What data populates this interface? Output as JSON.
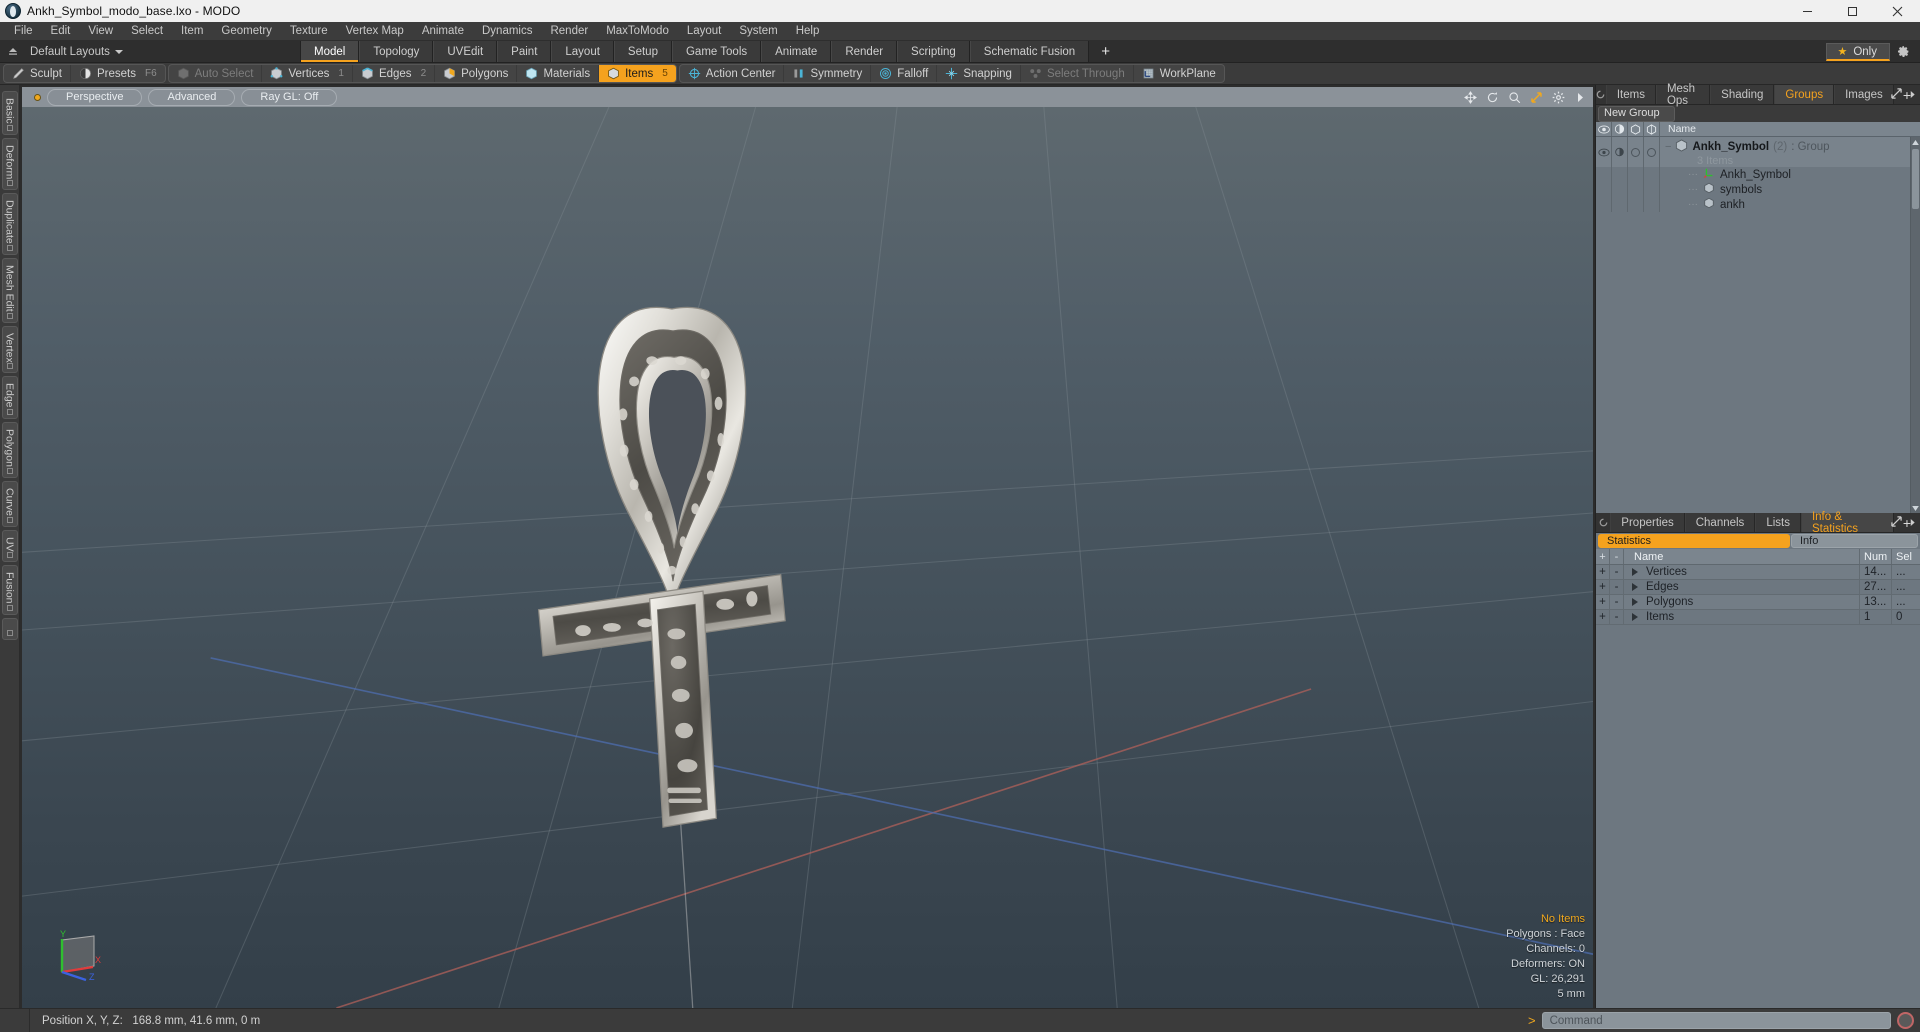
{
  "window": {
    "title": "Ankh_Symbol_modo_base.lxo - MODO",
    "app_icon": "modo-app-icon",
    "controls": {
      "minimize": "minimize-icon",
      "maximize": "maximize-icon",
      "close": "close-icon"
    }
  },
  "menu": {
    "items": [
      "File",
      "Edit",
      "View",
      "Select",
      "Item",
      "Geometry",
      "Texture",
      "Vertex Map",
      "Animate",
      "Dynamics",
      "Render",
      "MaxToModo",
      "Layout",
      "System",
      "Help"
    ]
  },
  "layout_bar": {
    "layout_selector": "Default Layouts",
    "tabs": [
      "Model",
      "Topology",
      "UVEdit",
      "Paint",
      "Layout",
      "Setup",
      "Game Tools",
      "Animate",
      "Render",
      "Scripting",
      "Schematic Fusion"
    ],
    "active_tab": "Model",
    "add_tab": "+",
    "only_label": "Only",
    "only_star": "★"
  },
  "mode_toolbar": {
    "groups": [
      {
        "buttons": [
          {
            "label": "Sculpt",
            "icon": "sculpt-icon",
            "state": "normal",
            "num": ""
          },
          {
            "label": "Presets",
            "icon": "presets-icon",
            "state": "normal",
            "num": "F6"
          }
        ]
      },
      {
        "buttons": [
          {
            "label": "Auto Select",
            "icon": "auto-select-icon",
            "state": "dim",
            "num": ""
          },
          {
            "label": "Vertices",
            "icon": "vertices-icon",
            "state": "normal",
            "num": "1"
          },
          {
            "label": "Edges",
            "icon": "edges-icon",
            "state": "normal",
            "num": "2"
          },
          {
            "label": "Polygons",
            "icon": "polygons-icon",
            "state": "normal",
            "num": ""
          },
          {
            "label": "Materials",
            "icon": "materials-icon",
            "state": "normal",
            "num": ""
          },
          {
            "label": "Items",
            "icon": "items-icon",
            "state": "selected",
            "num": "5"
          }
        ]
      },
      {
        "buttons": [
          {
            "label": "Action Center",
            "icon": "action-center-icon",
            "state": "normal",
            "num": ""
          },
          {
            "label": "Symmetry",
            "icon": "symmetry-icon",
            "state": "normal",
            "num": ""
          },
          {
            "label": "Falloff",
            "icon": "falloff-icon",
            "state": "normal",
            "num": ""
          },
          {
            "label": "Snapping",
            "icon": "snapping-icon",
            "state": "normal",
            "num": ""
          },
          {
            "label": "Select Through",
            "icon": "select-through-icon",
            "state": "dim",
            "num": ""
          },
          {
            "label": "WorkPlane",
            "icon": "workplane-icon",
            "state": "normal",
            "num": ""
          }
        ]
      }
    ]
  },
  "left_tabs": [
    "Basic",
    "Deform",
    "Duplicate",
    "Mesh Edit",
    "Vertex",
    "Edge",
    "Polygon",
    "Curve",
    "UV",
    "Fusion"
  ],
  "viewport": {
    "header_buttons": [
      "Perspective",
      "Advanced",
      "Ray GL: Off"
    ],
    "header_icons": [
      "pan-icon",
      "rotate-icon",
      "zoom-icon",
      "fit-icon",
      "gear-icon",
      "chevron-right-icon"
    ],
    "hud": {
      "no_items": "No Items",
      "polygons": "Polygons : Face",
      "channels": "Channels: 0",
      "deformers": "Deformers: ON",
      "gl": "GL: 26,291",
      "scale": "5 mm"
    },
    "gizmo_axes": {
      "x": "X",
      "y": "Y",
      "z": "Z"
    }
  },
  "items_panel": {
    "tabs": [
      "Items",
      "Mesh Ops",
      "Shading",
      "Groups",
      "Images"
    ],
    "active_tab": "Groups",
    "add_tab": "+",
    "new_group_label": "New Group",
    "columns": {
      "eye": "visibility-icon",
      "shade": "shading-icon",
      "render": "render-icon",
      "lock": "lock-icon",
      "name": "Name"
    },
    "group": {
      "name": "Ankh_Symbol",
      "count": "(2)",
      "type": ": Group",
      "sub_label": "3 Items",
      "children": [
        {
          "name": "Ankh_Symbol",
          "icon": "locator-icon"
        },
        {
          "name": "symbols",
          "icon": "mesh-icon"
        },
        {
          "name": "ankh",
          "icon": "mesh-icon"
        }
      ]
    }
  },
  "info_panel": {
    "tabs": [
      "Properties",
      "Channels",
      "Lists",
      "Info & Statistics"
    ],
    "active_tab": "Info & Statistics",
    "add_tab": "+",
    "sub_tabs": [
      "Statistics",
      "Info"
    ],
    "active_sub_tab": "Statistics",
    "columns": [
      "+",
      "-",
      "Name",
      "Num",
      "Sel"
    ],
    "rows": [
      {
        "plus": "+",
        "minus": "-",
        "name": "Vertices",
        "num": "14...",
        "sel": "..."
      },
      {
        "plus": "+",
        "minus": "-",
        "name": "Edges",
        "num": "27...",
        "sel": "..."
      },
      {
        "plus": "+",
        "minus": "-",
        "name": "Polygons",
        "num": "13...",
        "sel": "..."
      },
      {
        "plus": "+",
        "minus": "-",
        "name": "Items",
        "num": "1",
        "sel": "0"
      }
    ]
  },
  "status_bar": {
    "position_label": "Position X, Y, Z:",
    "position_value": "168.8 mm, 41.6 mm, 0 m",
    "command_placeholder": "Command",
    "prompt": ">",
    "record_icon": "record-icon"
  },
  "colors": {
    "accent_orange": "#f5a21e",
    "panel_blue_gray": "#6d7780",
    "titlebar": "#f0f0f0",
    "chrome_dark": "#3b3b3b"
  }
}
